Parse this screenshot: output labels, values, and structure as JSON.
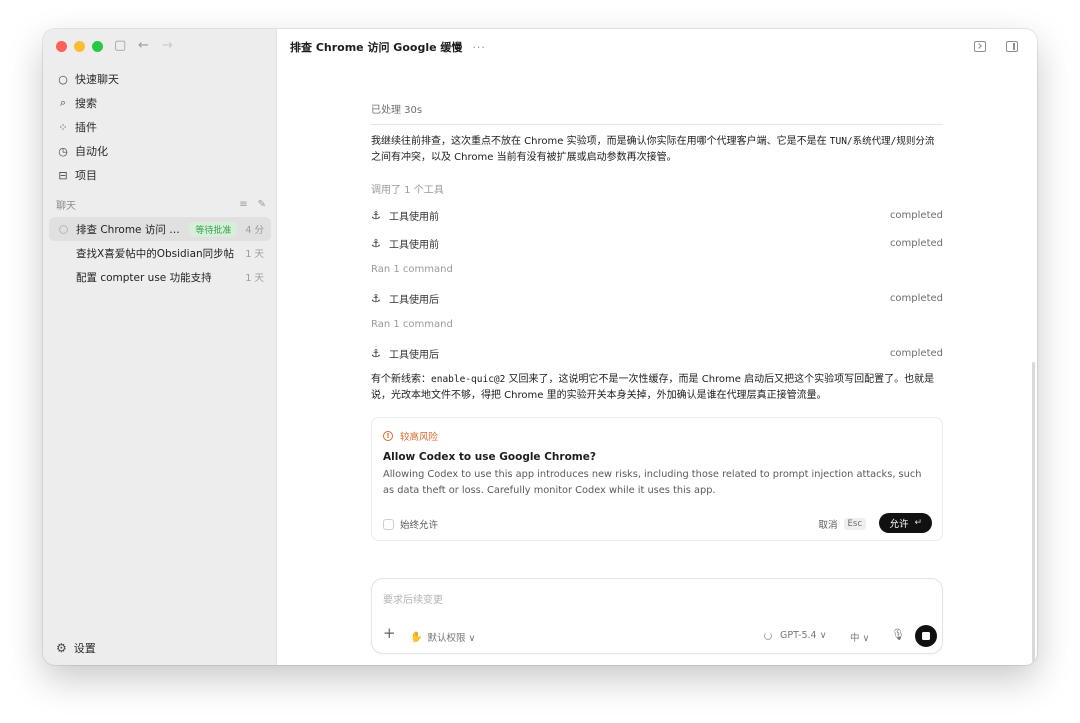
{
  "sidebar": {
    "nav": [
      {
        "icon": "chat-bubble-icon",
        "glyph": "○",
        "label": "快速聊天"
      },
      {
        "icon": "search-icon",
        "glyph": "⌕",
        "label": "搜索"
      },
      {
        "icon": "plugins-icon",
        "glyph": "⁘",
        "label": "插件"
      },
      {
        "icon": "clock-icon",
        "glyph": "◷",
        "label": "自动化"
      },
      {
        "icon": "folder-icon",
        "glyph": "⊟",
        "label": "项目"
      }
    ],
    "section_label": "聊天",
    "chats": [
      {
        "title": "排查 Chrome 访问 Go...",
        "badge": "等待批准",
        "time": "4 分",
        "active": true
      },
      {
        "title": "查找X喜爱帖中的Obsidian同步帖",
        "time": "1 天"
      },
      {
        "title": "配置 compter use 功能支持",
        "time": "1 天"
      }
    ],
    "settings_label": "设置"
  },
  "topbar": {
    "title": "排查 Chrome 访问 Google 缓慢",
    "more": "···"
  },
  "thread": {
    "processed": "已处理 30s",
    "para1_pre": "我继续往前排查，这次重点不放在 Chrome 实验项，而是确认你实际在用哪个代理客户端、它是不是在 ",
    "para1_code": "TUN/系统代理/规则分流",
    "para1_post": "之间有冲突，以及 Chrome 当前有没有被扩展或启动参数再次接管。",
    "tools_meta": "调用了 1 个工具",
    "tool_rows": [
      {
        "label": "工具使用前",
        "status": "completed"
      },
      {
        "label": "工具使用前",
        "status": "completed"
      },
      {
        "label": "工具使用后",
        "status": "completed"
      },
      {
        "label": "工具使用后",
        "status": "completed"
      }
    ],
    "ran_meta_1": "Ran 1 command",
    "ran_meta_2": "Ran 1 command",
    "para2_pre": "有个新线索：",
    "para2_code": "enable-quic@2",
    "para2_post": " 又回来了，这说明它不是一次性缓存，而是 Chrome 启动后又把这个实验项写回配置了。也就是说，光改本地文件不够，得把 Chrome 里的实验开关本身关掉，外加确认是谁在代理层真正接管流量。"
  },
  "approval": {
    "risk_label": "较高风险",
    "title": "Allow Codex to use Google Chrome?",
    "description": "Allowing Codex to use this app introduces new risks, including those related to prompt injection attacks, such as data theft or loss. Carefully monitor Codex while it uses this app.",
    "always_allow": "始终允许",
    "cancel": "取消",
    "cancel_key": "Esc",
    "allow": "允许",
    "allow_key": "↵"
  },
  "composer": {
    "placeholder": "要求后续变更",
    "permission": "默认权限 ∨",
    "model": "GPT-5.4 ∨",
    "language": "中 ∨"
  },
  "colors": {
    "badge_bg": "#d7efd9",
    "badge_text": "#38a34f",
    "risk": "#d9692b"
  }
}
